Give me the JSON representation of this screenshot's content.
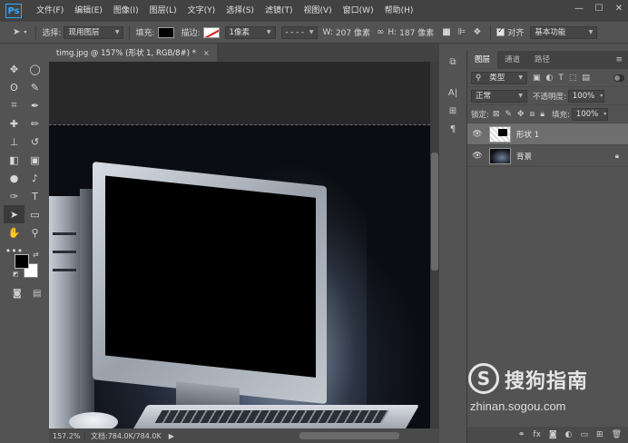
{
  "app": {
    "logo": "Ps"
  },
  "menu": [
    "文件(F)",
    "编辑(E)",
    "图像(I)",
    "图层(L)",
    "文字(Y)",
    "选择(S)",
    "滤镜(T)",
    "视图(V)",
    "窗口(W)",
    "帮助(H)"
  ],
  "options": {
    "select_label": "选择:",
    "select_value": "现用图层",
    "fill_label": "填充:",
    "stroke_label": "描边:",
    "stroke_width": "1像素",
    "w_label": "W:",
    "w_value": "207 像素",
    "h_label": "H:",
    "h_value": "187 像素",
    "align_label": "对齐",
    "workspace": "基本功能"
  },
  "document": {
    "tab_title": "timg.jpg @ 157% (形状 1, RGB/8#) *",
    "close": "×"
  },
  "status": {
    "zoom": "157.2%",
    "doc_info": "文档:784.0K/784.0K"
  },
  "layers_panel": {
    "tabs": [
      "图层",
      "通道",
      "路径"
    ],
    "filter_kind": "类型",
    "blend_mode": "正常",
    "opacity_label": "不透明度:",
    "opacity_value": "100%",
    "lock_label": "锁定:",
    "fill_label": "填充:",
    "fill_value": "100%",
    "layers": [
      {
        "name": "形状 1",
        "selected": true
      },
      {
        "name": "背景",
        "locked": true
      }
    ]
  },
  "watermark": {
    "logo": "S",
    "text": "搜狗指南",
    "url": "zhinan.sogou.com"
  },
  "colors": {
    "accent": "#31a8ff",
    "panel_bg": "#535353",
    "bar_bg": "#424242",
    "canvas_bg": "#282828"
  }
}
